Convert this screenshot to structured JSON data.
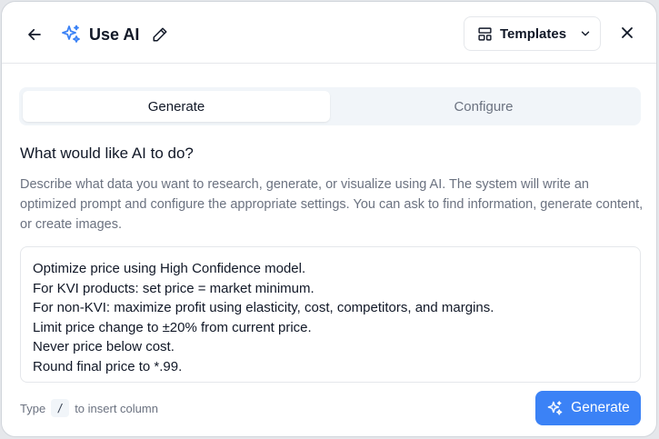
{
  "header": {
    "title": "Use AI",
    "templates_label": "Templates"
  },
  "tabs": [
    {
      "label": "Generate",
      "active": true
    },
    {
      "label": "Configure",
      "active": false
    }
  ],
  "main": {
    "question": "What would like AI to do?",
    "description": "Describe what data you want to research, generate, or visualize using AI. The system will write an optimized prompt and configure the appropriate settings. You can ask to find information, generate content, or create images.",
    "prompt_lines": [
      "Optimize price using High Confidence model.",
      "For KVI products: set price = market minimum.",
      "For non-KVI: maximize profit using elasticity, cost, competitors, and margins.",
      "Limit price change to ±20% from current price.",
      "Never price below cost.",
      "Round final price to *.99."
    ]
  },
  "footer": {
    "hint_prefix": "Type",
    "hint_key": "/",
    "hint_suffix": "to insert column",
    "generate_label": "Generate"
  },
  "icons": {
    "back": "arrow-left-icon",
    "sparkle": "sparkle-icon",
    "edit": "pencil-icon",
    "templates": "layout-template-icon",
    "chevron": "chevron-down-icon",
    "close": "close-icon"
  },
  "colors": {
    "accent": "#3b82f6",
    "tab_bg": "#f1f5f9",
    "muted_text": "#6b7280"
  }
}
